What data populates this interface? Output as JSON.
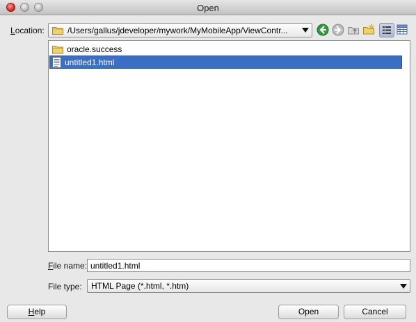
{
  "window": {
    "title": "Open"
  },
  "location": {
    "label": "Location:",
    "label_mnemonic": "L",
    "label_rest": "ocation:",
    "path": "/Users/gallus/jdeveloper/mywork/MyMobileApp/ViewContr..."
  },
  "toolbar": {
    "icons": [
      "back-icon",
      "forward-icon",
      "up-folder-icon",
      "new-folder-icon",
      "list-view-icon",
      "details-view-icon"
    ]
  },
  "files": [
    {
      "name": "oracle.success",
      "icon": "folder-icon",
      "selected": false
    },
    {
      "name": "untitled1.html",
      "icon": "html-file-icon",
      "selected": true
    }
  ],
  "filename": {
    "label_mnemonic": "F",
    "label_rest": "ile name:",
    "value": "untitled1.html"
  },
  "filetype": {
    "label": "File type:",
    "value": "HTML Page (*.html, *.htm)"
  },
  "buttons": {
    "help_mnemonic": "H",
    "help_rest": "elp",
    "open": "Open",
    "cancel": "Cancel"
  },
  "colors": {
    "selection": "#3a6fc6",
    "nav_green": "#2f9a3a"
  }
}
